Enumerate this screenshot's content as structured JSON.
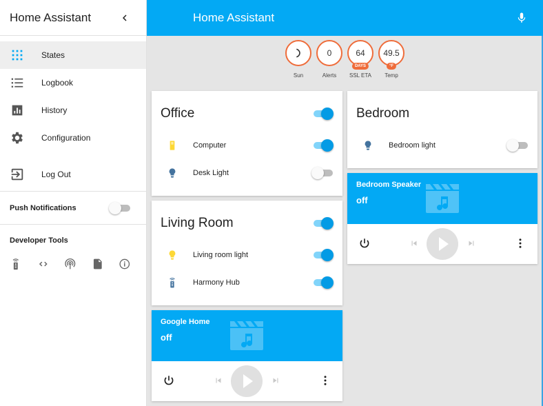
{
  "sidebar": {
    "title": "Home Assistant",
    "back_icon": "chevron-left-icon",
    "nav": [
      {
        "label": "States",
        "icon": "apps-grid-icon",
        "active": true
      },
      {
        "label": "Logbook",
        "icon": "list-icon",
        "active": false
      },
      {
        "label": "History",
        "icon": "bar-chart-icon",
        "active": false
      },
      {
        "label": "Configuration",
        "icon": "gear-icon",
        "active": false
      }
    ],
    "logout": {
      "label": "Log Out",
      "icon": "logout-icon"
    },
    "push_notifications": {
      "label": "Push Notifications",
      "enabled": false
    },
    "developer_tools": {
      "label": "Developer Tools",
      "tools": [
        "remote-icon",
        "code-icon",
        "broadcast-icon",
        "file-code-icon",
        "info-icon"
      ]
    }
  },
  "header": {
    "title": "Home Assistant",
    "mic_icon": "microphone-icon"
  },
  "badges": [
    {
      "value": "",
      "icon": "moon-icon",
      "label": "Sun",
      "unit": ""
    },
    {
      "value": "0",
      "label": "Alerts",
      "unit": ""
    },
    {
      "value": "64",
      "label": "SSL ETA",
      "unit": "DAYS"
    },
    {
      "value": "49.5",
      "label": "Temp",
      "unit": "°F"
    }
  ],
  "cards": {
    "office": {
      "title": "Office",
      "enabled": true,
      "entities": [
        {
          "name": "Computer",
          "icon": "computer-icon",
          "on": true
        },
        {
          "name": "Desk Light",
          "icon": "lightbulb-icon",
          "on": false
        }
      ]
    },
    "living_room": {
      "title": "Living Room",
      "enabled": true,
      "entities": [
        {
          "name": "Living room light",
          "icon": "lightbulb-icon",
          "on": true
        },
        {
          "name": "Harmony Hub",
          "icon": "remote-icon",
          "on": true
        }
      ]
    },
    "google_home": {
      "name": "Google Home",
      "state": "off"
    },
    "bedroom": {
      "title": "Bedroom",
      "entities": [
        {
          "name": "Bedroom light",
          "icon": "lightbulb-icon",
          "on": false
        }
      ]
    },
    "bedroom_speaker": {
      "name": "Bedroom Speaker",
      "state": "off"
    }
  },
  "colors": {
    "primary": "#03a9f4",
    "badge_border": "#ef6c3a",
    "toggle_on": "#039be5",
    "toggle_off": "#bdbdbd",
    "light_on": "#fdd835",
    "light_off": "#44739e"
  }
}
